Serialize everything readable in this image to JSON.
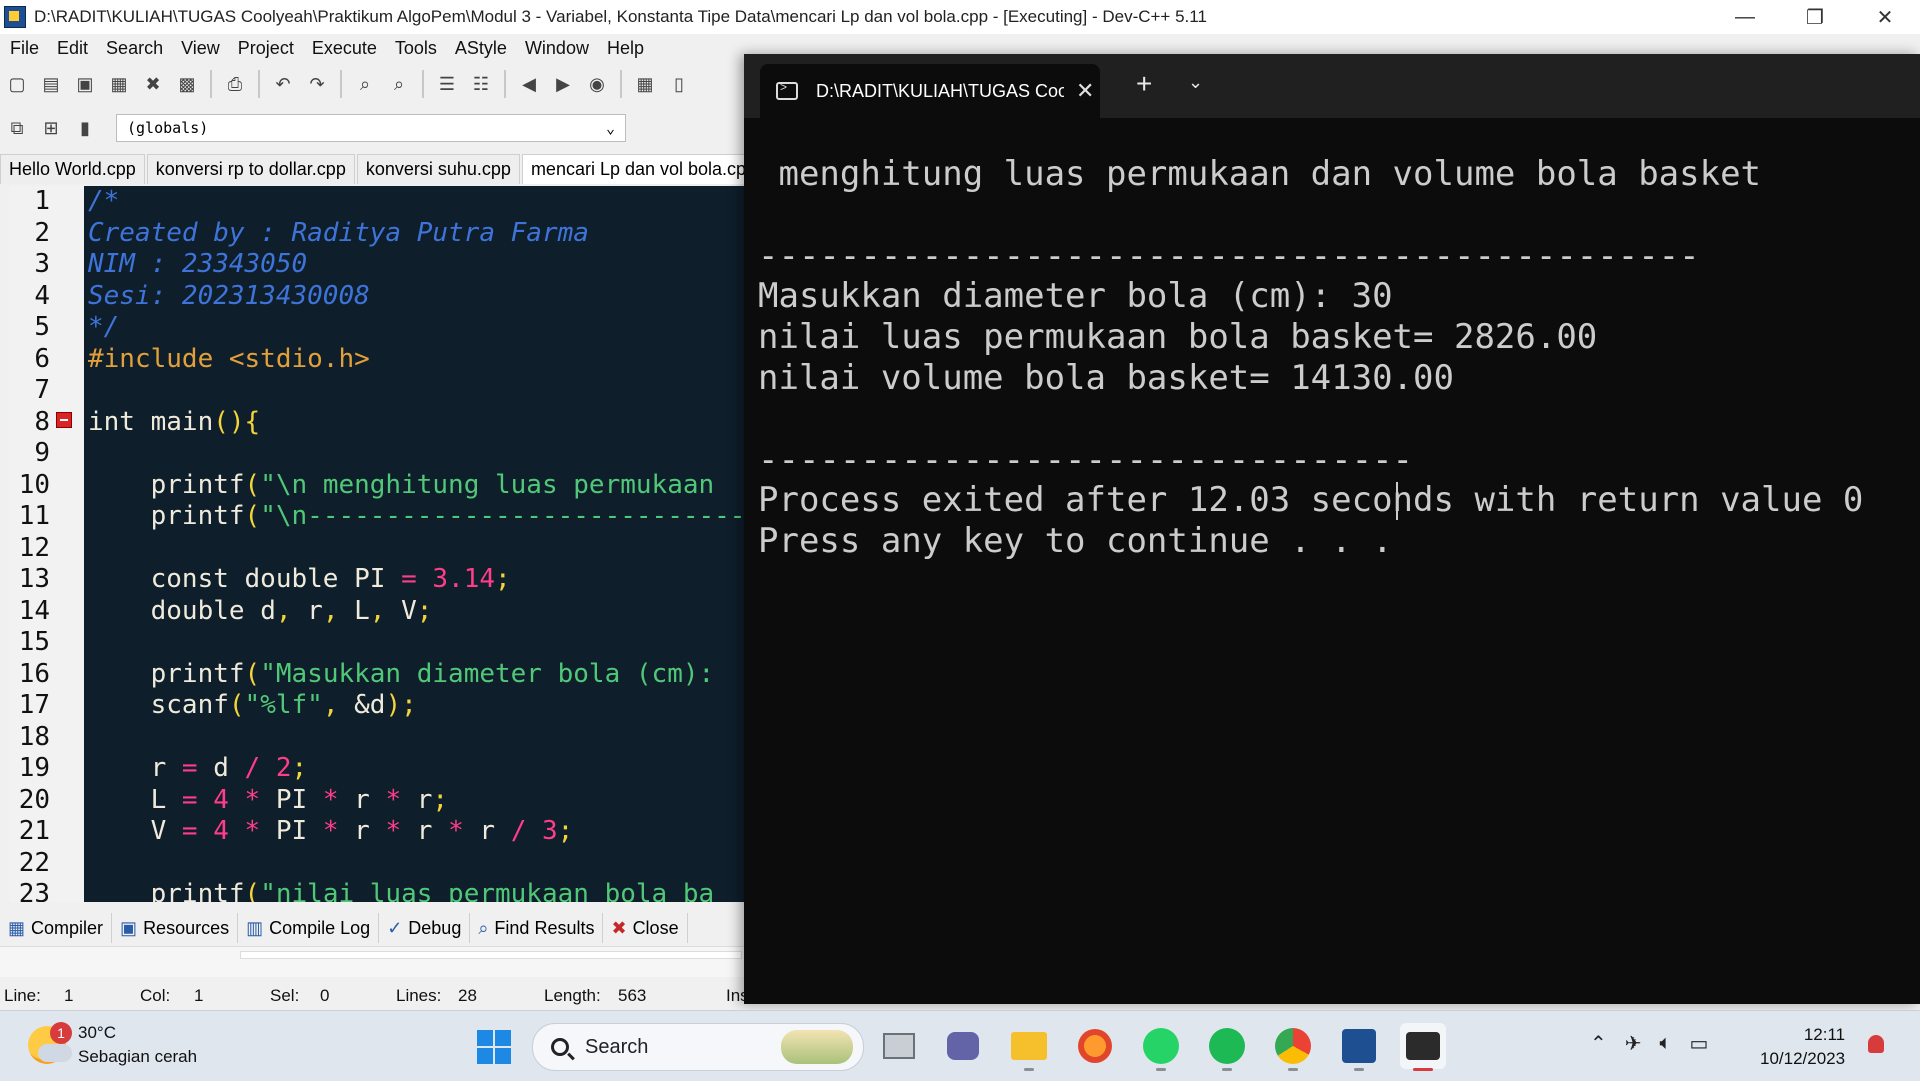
{
  "window": {
    "title": "D:\\RADIT\\KULIAH\\TUGAS Coolyeah\\Praktikum AlgoPem\\Modul 3 - Variabel, Konstanta  Tipe Data\\mencari Lp dan vol bola.cpp - [Executing] - Dev-C++ 5.11",
    "minimize": "—",
    "restore": "❐",
    "close": "✕"
  },
  "menu": [
    "File",
    "Edit",
    "Search",
    "View",
    "Project",
    "Execute",
    "Tools",
    "AStyle",
    "Window",
    "Help"
  ],
  "toolbar": {
    "globals_value": "(globals)"
  },
  "file_tabs": [
    "Hello World.cpp",
    "konversi rp to dollar.cpp",
    "konversi suhu.cpp",
    "mencari Lp dan vol bola.cpp"
  ],
  "editor": {
    "line_numbers": [
      "1",
      "2",
      "3",
      "4",
      "5",
      "6",
      "7",
      "8",
      "9",
      "10",
      "11",
      "12",
      "13",
      "14",
      "15",
      "16",
      "17",
      "18",
      "19",
      "20",
      "21",
      "22",
      "23"
    ],
    "lines": [
      [
        {
          "t": "/*",
          "c": "comment"
        }
      ],
      [
        {
          "t": "Created by : Raditya Putra Farma",
          "c": "comment"
        }
      ],
      [
        {
          "t": "NIM : 23343050",
          "c": "comment"
        }
      ],
      [
        {
          "t": "Sesi: 202313430008",
          "c": "comment"
        }
      ],
      [
        {
          "t": "*/",
          "c": "comment"
        }
      ],
      [
        {
          "t": "#include <stdio.h>",
          "c": "pre"
        }
      ],
      [],
      [
        {
          "t": "int",
          "c": "kw"
        },
        {
          "t": " main",
          "c": "plain"
        },
        {
          "t": "(){",
          "c": "punct"
        }
      ],
      [],
      [
        {
          "t": "    printf",
          "c": "plain"
        },
        {
          "t": "(",
          "c": "punct"
        },
        {
          "t": "\"\\n menghitung luas permukaan",
          "c": "str"
        }
      ],
      [
        {
          "t": "    printf",
          "c": "plain"
        },
        {
          "t": "(",
          "c": "punct"
        },
        {
          "t": "\"\\n------------------------------",
          "c": "str"
        }
      ],
      [],
      [
        {
          "t": "    const double",
          "c": "kw"
        },
        {
          "t": " PI ",
          "c": "plain"
        },
        {
          "t": "=",
          "c": "op"
        },
        {
          "t": " 3.14",
          "c": "num"
        },
        {
          "t": ";",
          "c": "punct"
        }
      ],
      [
        {
          "t": "    double",
          "c": "kw"
        },
        {
          "t": " d",
          "c": "plain"
        },
        {
          "t": ",",
          "c": "punct"
        },
        {
          "t": " r",
          "c": "plain"
        },
        {
          "t": ",",
          "c": "punct"
        },
        {
          "t": " L",
          "c": "plain"
        },
        {
          "t": ",",
          "c": "punct"
        },
        {
          "t": " V",
          "c": "plain"
        },
        {
          "t": ";",
          "c": "punct"
        }
      ],
      [],
      [
        {
          "t": "    printf",
          "c": "plain"
        },
        {
          "t": "(",
          "c": "punct"
        },
        {
          "t": "\"Masukkan diameter bola (cm):",
          "c": "str"
        }
      ],
      [
        {
          "t": "    scanf",
          "c": "plain"
        },
        {
          "t": "(",
          "c": "punct"
        },
        {
          "t": "\"%lf\"",
          "c": "str"
        },
        {
          "t": ",",
          "c": "punct"
        },
        {
          "t": " &d",
          "c": "plain"
        },
        {
          "t": ");",
          "c": "punct"
        }
      ],
      [],
      [
        {
          "t": "    r ",
          "c": "plain"
        },
        {
          "t": "=",
          "c": "op"
        },
        {
          "t": " d ",
          "c": "plain"
        },
        {
          "t": "/",
          "c": "op"
        },
        {
          "t": " 2",
          "c": "num"
        },
        {
          "t": ";",
          "c": "punct"
        }
      ],
      [
        {
          "t": "    L ",
          "c": "plain"
        },
        {
          "t": "=",
          "c": "op"
        },
        {
          "t": " 4",
          "c": "num"
        },
        {
          "t": " *",
          "c": "op"
        },
        {
          "t": " PI ",
          "c": "plain"
        },
        {
          "t": "*",
          "c": "op"
        },
        {
          "t": " r ",
          "c": "plain"
        },
        {
          "t": "*",
          "c": "op"
        },
        {
          "t": " r",
          "c": "plain"
        },
        {
          "t": ";",
          "c": "punct"
        }
      ],
      [
        {
          "t": "    V ",
          "c": "plain"
        },
        {
          "t": "=",
          "c": "op"
        },
        {
          "t": " 4",
          "c": "num"
        },
        {
          "t": " *",
          "c": "op"
        },
        {
          "t": " PI ",
          "c": "plain"
        },
        {
          "t": "*",
          "c": "op"
        },
        {
          "t": " r ",
          "c": "plain"
        },
        {
          "t": "*",
          "c": "op"
        },
        {
          "t": " r ",
          "c": "plain"
        },
        {
          "t": "*",
          "c": "op"
        },
        {
          "t": " r ",
          "c": "plain"
        },
        {
          "t": "/",
          "c": "op"
        },
        {
          "t": " 3",
          "c": "num"
        },
        {
          "t": ";",
          "c": "punct"
        }
      ],
      [],
      [
        {
          "t": "    printf",
          "c": "plain"
        },
        {
          "t": "(",
          "c": "punct"
        },
        {
          "t": "\"nilai luas permukaan bola ba",
          "c": "str"
        }
      ]
    ]
  },
  "bottom_tabs": [
    "Compiler",
    "Resources",
    "Compile Log",
    "Debug",
    "Find Results",
    "Close"
  ],
  "status": {
    "line_label": "Line:",
    "line_value": "1",
    "col_label": "Col:",
    "col_value": "1",
    "sel_label": "Sel:",
    "sel_value": "0",
    "lines_label": "Lines:",
    "lines_value": "28",
    "length_label": "Length:",
    "length_value": "563",
    "ins": "Ins"
  },
  "terminal": {
    "tab_title": "D:\\RADIT\\KULIAH\\TUGAS Coolyeah\\Praktikum",
    "new_tab": "+",
    "dropdown": "⌄",
    "tab_close": "✕",
    "output": [
      " menghitung luas permukaan dan volume bola basket",
      "",
      "----------------------------------------------",
      "Masukkan diameter bola (cm): 30",
      "nilai luas permukaan bola basket= 2826.00",
      "nilai volume bola basket= 14130.00",
      "",
      "--------------------------------",
      "Process exited after 12.03 seconds with return value 0",
      "Press any key to continue . . . "
    ]
  },
  "taskbar": {
    "weather_temp": "30°C",
    "weather_desc": "Sebagian cerah",
    "weather_badge": "1",
    "search_label": "Search",
    "time": "12:11",
    "date": "10/12/2023"
  }
}
